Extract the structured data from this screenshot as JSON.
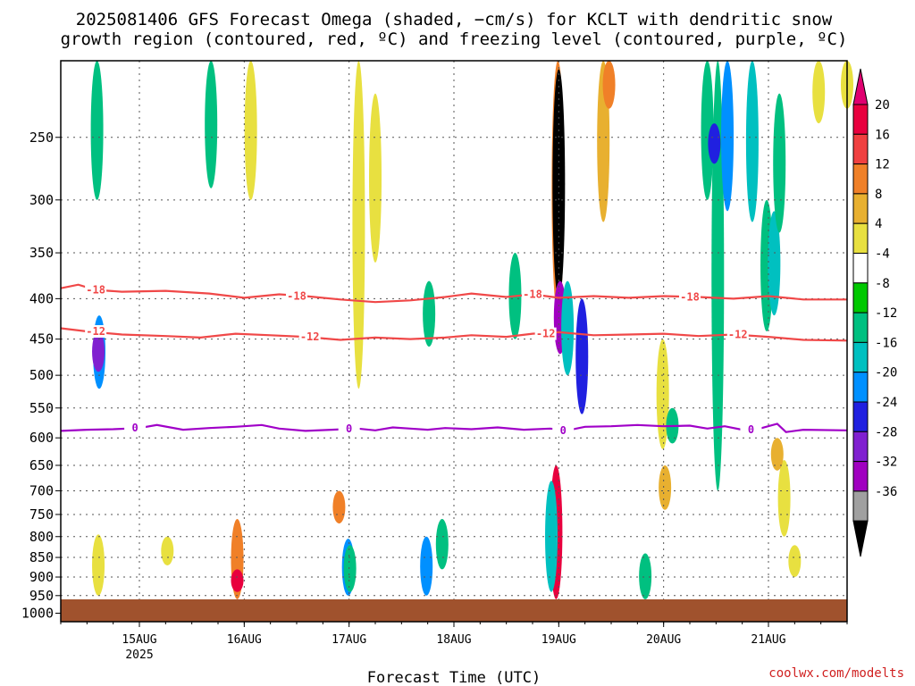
{
  "chart_data": {
    "type": "heatmap",
    "title_line1": "2025081406 GFS Forecast Omega (shaded, −cm/s) for KCLT with dendritic snow",
    "title_line2": "growth region (contoured, red, ºC) and freezing level (contoured, purple, ºC)",
    "xlabel": "Forecast Time (UTC)",
    "ylabel": "",
    "credit": "coolwx.com/modelts",
    "x_ticks": [
      {
        "label": "15AUG",
        "sub": "2025",
        "t": 24
      },
      {
        "label": "16AUG",
        "sub": "",
        "t": 48
      },
      {
        "label": "17AUG",
        "sub": "",
        "t": 72
      },
      {
        "label": "18AUG",
        "sub": "",
        "t": 96
      },
      {
        "label": "19AUG",
        "sub": "",
        "t": 120
      },
      {
        "label": "20AUG",
        "sub": "",
        "t": 144
      },
      {
        "label": "21AUG",
        "sub": "",
        "t": 168
      }
    ],
    "xlim": [
      6,
      186
    ],
    "y_ticks": [
      250,
      300,
      350,
      400,
      450,
      500,
      550,
      600,
      650,
      700,
      750,
      800,
      850,
      900,
      950,
      1000
    ],
    "ylim_hpa": [
      200,
      1025
    ],
    "y_scale": "log-pressure",
    "grid": true,
    "colorbar": {
      "levels": [
        "20",
        "16",
        "12",
        "8",
        "4",
        "-4",
        "-8",
        "-12",
        "-16",
        "-20",
        "-24",
        "-28",
        "-32",
        "-36"
      ],
      "colors": [
        "#e8003e",
        "#f04040",
        "#f08028",
        "#e8b030",
        "#e8e040",
        "#ffffff",
        "#00c800",
        "#00c080",
        "#00c0c0",
        "#0090ff",
        "#2020e0",
        "#8020d0",
        "#a000c0",
        "#a0a0a0"
      ],
      "top_color": "#e00070",
      "bottom_color": "#000000"
    },
    "ground_color": "#a0522d",
    "contours": [
      {
        "name": "-18",
        "color": "#f04848",
        "labels_at": [
          14,
          60,
          114,
          150
        ],
        "points": [
          [
            6,
            388
          ],
          [
            10,
            384
          ],
          [
            14,
            390
          ],
          [
            20,
            392
          ],
          [
            30,
            391
          ],
          [
            40,
            394
          ],
          [
            48,
            399
          ],
          [
            56,
            395
          ],
          [
            62,
            397
          ],
          [
            70,
            401
          ],
          [
            78,
            404
          ],
          [
            86,
            402
          ],
          [
            94,
            398
          ],
          [
            100,
            394
          ],
          [
            108,
            398
          ],
          [
            114,
            395
          ],
          [
            120,
            399
          ],
          [
            128,
            397
          ],
          [
            136,
            399
          ],
          [
            144,
            397
          ],
          [
            152,
            398
          ],
          [
            160,
            400
          ],
          [
            168,
            397
          ],
          [
            176,
            401
          ],
          [
            186,
            401
          ]
        ]
      },
      {
        "name": "-12",
        "color": "#f04848",
        "labels_at": [
          14,
          63,
          117,
          161
        ],
        "points": [
          [
            6,
            436
          ],
          [
            12,
            440
          ],
          [
            20,
            444
          ],
          [
            30,
            446
          ],
          [
            38,
            448
          ],
          [
            46,
            443
          ],
          [
            54,
            445
          ],
          [
            62,
            447
          ],
          [
            70,
            451
          ],
          [
            78,
            448
          ],
          [
            86,
            450
          ],
          [
            94,
            448
          ],
          [
            100,
            445
          ],
          [
            108,
            447
          ],
          [
            114,
            443
          ],
          [
            120,
            441
          ],
          [
            128,
            445
          ],
          [
            136,
            444
          ],
          [
            144,
            443
          ],
          [
            152,
            446
          ],
          [
            160,
            444
          ],
          [
            168,
            447
          ],
          [
            176,
            451
          ],
          [
            186,
            452
          ]
        ]
      },
      {
        "name": "0",
        "color": "#a000c8",
        "labels_at": [
          23,
          72,
          121,
          164
        ],
        "points": [
          [
            6,
            588
          ],
          [
            12,
            586
          ],
          [
            18,
            585
          ],
          [
            24,
            583
          ],
          [
            28,
            578
          ],
          [
            34,
            586
          ],
          [
            40,
            583
          ],
          [
            46,
            581
          ],
          [
            52,
            578
          ],
          [
            56,
            584
          ],
          [
            62,
            588
          ],
          [
            68,
            586
          ],
          [
            74,
            584
          ],
          [
            78,
            587
          ],
          [
            82,
            582
          ],
          [
            86,
            584
          ],
          [
            90,
            586
          ],
          [
            94,
            583
          ],
          [
            100,
            585
          ],
          [
            106,
            582
          ],
          [
            112,
            586
          ],
          [
            118,
            584
          ],
          [
            122,
            587
          ],
          [
            126,
            581
          ],
          [
            132,
            580
          ],
          [
            138,
            578
          ],
          [
            144,
            580
          ],
          [
            150,
            579
          ],
          [
            154,
            584
          ],
          [
            158,
            580
          ],
          [
            162,
            586
          ],
          [
            166,
            584
          ],
          [
            170,
            576
          ],
          [
            172,
            590
          ],
          [
            176,
            586
          ],
          [
            186,
            587
          ]
        ]
      }
    ],
    "cells": [
      {
        "t": 14.8,
        "p1": 420,
        "p2": 520,
        "v": -16
      },
      {
        "t": 14.6,
        "p1": 440,
        "p2": 495,
        "v": -24
      },
      {
        "t": 14.3,
        "p1": 200,
        "p2": 300,
        "v": -8
      },
      {
        "t": 14.6,
        "p1": 795,
        "p2": 950,
        "v": 6
      },
      {
        "t": 30.4,
        "p1": 800,
        "p2": 870,
        "v": 6
      },
      {
        "t": 46.4,
        "p1": 760,
        "p2": 960,
        "v": 12
      },
      {
        "t": 46.4,
        "p1": 880,
        "p2": 940,
        "v": 18
      },
      {
        "t": 40.4,
        "p1": 200,
        "p2": 290,
        "v": -8
      },
      {
        "t": 49.5,
        "p1": 200,
        "p2": 300,
        "v": 6
      },
      {
        "t": 71.8,
        "p1": 805,
        "p2": 950,
        "v": -16
      },
      {
        "t": 72.2,
        "p1": 820,
        "p2": 940,
        "v": -8
      },
      {
        "t": 69.7,
        "p1": 700,
        "p2": 770,
        "v": 12
      },
      {
        "t": 74.2,
        "p1": 200,
        "p2": 520,
        "v": 6
      },
      {
        "t": 78.0,
        "p1": 220,
        "p2": 360,
        "v": 6
      },
      {
        "t": 89.7,
        "p1": 800,
        "p2": 950,
        "v": -16
      },
      {
        "t": 93.3,
        "p1": 760,
        "p2": 880,
        "v": -8
      },
      {
        "t": 90.3,
        "p1": 380,
        "p2": 460,
        "v": -8
      },
      {
        "t": 110.0,
        "p1": 350,
        "p2": 450,
        "v": -8
      },
      {
        "t": 119.8,
        "p1": 200,
        "p2": 420,
        "v": 12
      },
      {
        "t": 120.0,
        "p1": 205,
        "p2": 400,
        "v": -36
      },
      {
        "t": 120.3,
        "p1": 380,
        "p2": 470,
        "v": -28
      },
      {
        "t": 122.0,
        "p1": 380,
        "p2": 500,
        "v": -12
      },
      {
        "t": 119.4,
        "p1": 650,
        "p2": 960,
        "v": 18
      },
      {
        "t": 118.3,
        "p1": 680,
        "p2": 940,
        "v": -12
      },
      {
        "t": 125.3,
        "p1": 400,
        "p2": 560,
        "v": -20
      },
      {
        "t": 130.2,
        "p1": 200,
        "p2": 320,
        "v": 8
      },
      {
        "t": 131.5,
        "p1": 200,
        "p2": 230,
        "v": 14
      },
      {
        "t": 139.8,
        "p1": 840,
        "p2": 960,
        "v": -8
      },
      {
        "t": 143.8,
        "p1": 450,
        "p2": 620,
        "v": 6
      },
      {
        "t": 144.3,
        "p1": 650,
        "p2": 740,
        "v": 10
      },
      {
        "t": 146.0,
        "p1": 550,
        "p2": 610,
        "v": -8
      },
      {
        "t": 154.0,
        "p1": 200,
        "p2": 300,
        "v": -8
      },
      {
        "t": 156.4,
        "p1": 200,
        "p2": 700,
        "v": -8
      },
      {
        "t": 158.6,
        "p1": 200,
        "p2": 310,
        "v": -16
      },
      {
        "t": 155.6,
        "p1": 240,
        "p2": 270,
        "v": -20
      },
      {
        "t": 164.3,
        "p1": 200,
        "p2": 320,
        "v": -12
      },
      {
        "t": 167.6,
        "p1": 300,
        "p2": 440,
        "v": -8
      },
      {
        "t": 169.3,
        "p1": 310,
        "p2": 420,
        "v": -12
      },
      {
        "t": 170.5,
        "p1": 220,
        "p2": 330,
        "v": -8
      },
      {
        "t": 171.6,
        "p1": 640,
        "p2": 800,
        "v": 6
      },
      {
        "t": 170.0,
        "p1": 600,
        "p2": 660,
        "v": 10
      },
      {
        "t": 174.0,
        "p1": 820,
        "p2": 900,
        "v": 6
      },
      {
        "t": 179.5,
        "p1": 200,
        "p2": 240,
        "v": 6
      },
      {
        "t": 186.0,
        "p1": 200,
        "p2": 230,
        "v": 6
      }
    ]
  }
}
